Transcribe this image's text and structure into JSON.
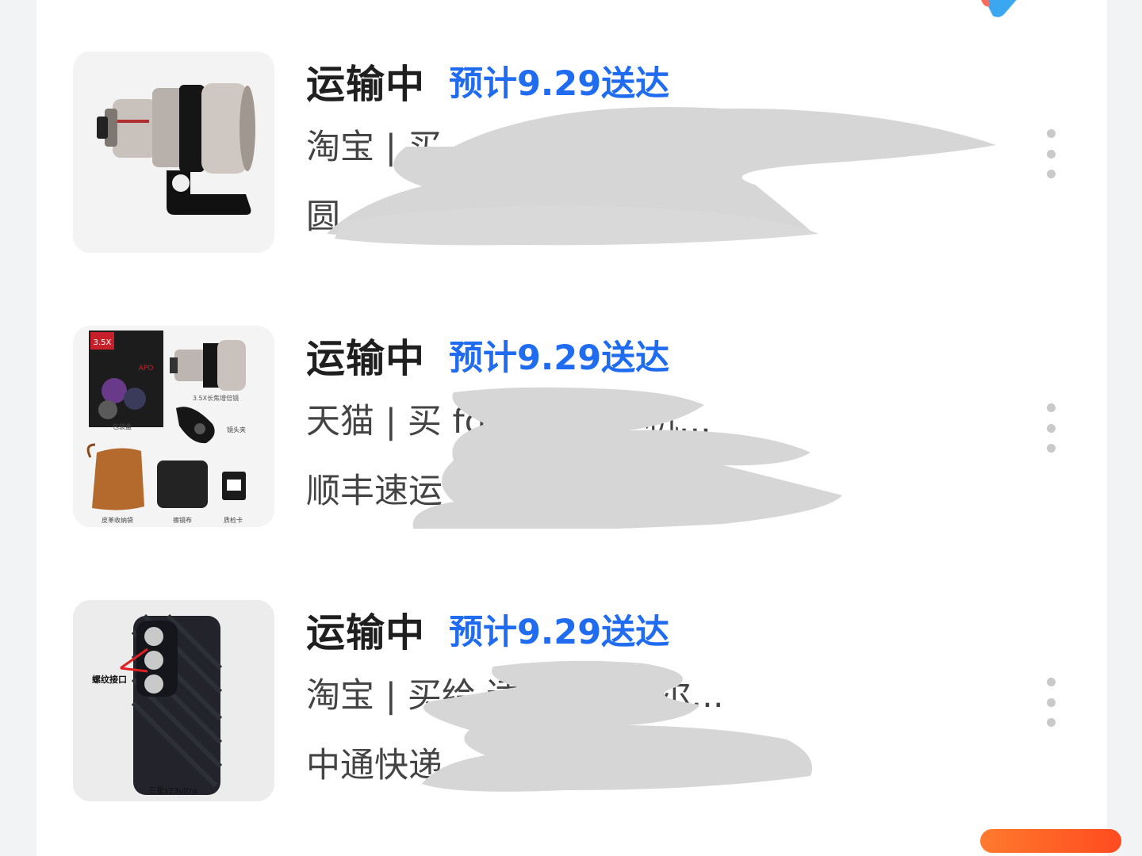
{
  "accent_color": "#1f6cf1",
  "orders": [
    {
      "status": "运输中",
      "eta": "预计9.29送达",
      "line2": "淘宝 | 买",
      "line3": "圆",
      "product_image": "telephoto-lens-on-mount"
    },
    {
      "status": "运输中",
      "eta": "预计9.29送达",
      "line2": "天猫 | 买              fotorgear手机...",
      "line3": "顺丰速运 |",
      "product_image": "lens-kit-contents",
      "image_labels": {
        "box_badge": "3.5X",
        "box_apo": "APO",
        "lens_caption": "3.5X长焦增倍镜",
        "package": "包装盒",
        "clip": "镜头夹",
        "pouch": "皮革收纳袋",
        "cloth": "擦镜布",
        "card": "质检卡"
      }
    },
    {
      "status": "运输中",
      "eta": "预计9.29送达",
      "line2": "淘宝 | 买给                      适合卡色纽尔...",
      "line3": "中通快递",
      "product_image": "phone-case-with-thread-mount",
      "image_labels": {
        "thread": "螺纹接口",
        "model": "三星s23ultra"
      }
    }
  ]
}
